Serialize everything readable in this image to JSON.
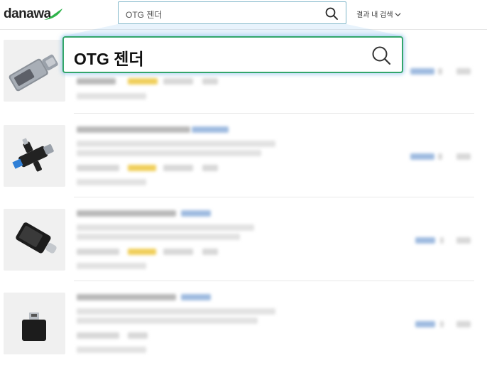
{
  "header": {
    "logo_text": "danawa",
    "search_value": "OTG 젠더",
    "search_within_label": "결과 내 검색"
  },
  "callout": {
    "search_value": "OTG 젠더"
  },
  "icons": {
    "search": "search-icon",
    "chevron": "chevron-down-icon"
  },
  "colors": {
    "brand_green": "#2eb34a",
    "focus_border": "#33a66b",
    "glow": "#78b4e6"
  },
  "results": [
    {
      "image": "usb-c-to-usb-a-adapter-silver"
    },
    {
      "image": "otg-dual-adapter-black"
    },
    {
      "image": "usb-c-otg-adapter-black"
    },
    {
      "image": "micro-usb-otg-adapter-black"
    }
  ]
}
